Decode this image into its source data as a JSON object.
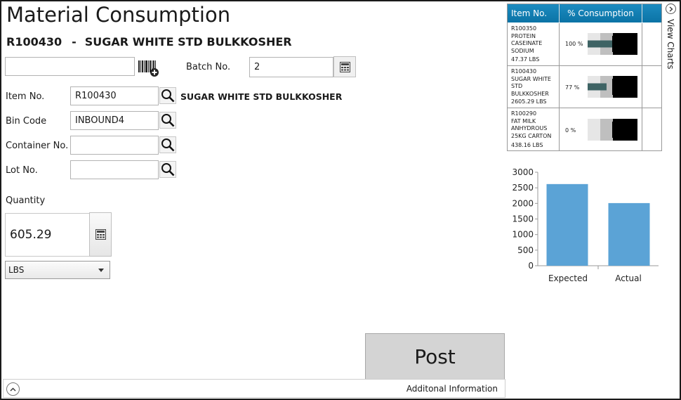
{
  "header": {
    "title": "Material Consumption",
    "item_code": "R100430",
    "separator": "-",
    "item_desc": "SUGAR WHITE STD BULKKOSHER"
  },
  "scan": {
    "value": "",
    "barcode_icon": "barcode-scan-icon"
  },
  "batch": {
    "label": "Batch No.",
    "value": "2",
    "calc_icon": "calculator-icon"
  },
  "form": {
    "item": {
      "label": "Item No.",
      "value": "R100430",
      "desc": "SUGAR WHITE STD BULKKOSHER"
    },
    "bin": {
      "label": "Bin Code",
      "value": "INBOUND4"
    },
    "container": {
      "label": "Container No.",
      "value": ""
    },
    "lot": {
      "label": "Lot No.",
      "value": ""
    },
    "search_icon": "magnifier-icon"
  },
  "quantity": {
    "label": "Quantity",
    "value": "605.29",
    "uom": "LBS"
  },
  "actions": {
    "post_label": "Post"
  },
  "footer": {
    "info_label": "Additonal Information",
    "expand_icon": "chevron-up-icon"
  },
  "side_tab": {
    "label": "View Charts",
    "icon": "chevron-right-icon"
  },
  "consumption_table": {
    "headers": [
      "Item No.",
      "% Consumption"
    ],
    "rows": [
      {
        "item_no": "R100350",
        "desc_lines": [
          "PROTEIN",
          "CASEINATE",
          "SODIUM"
        ],
        "qty": "47.37  LBS",
        "pct_label": "100 %",
        "pct": 100
      },
      {
        "item_no": "R100430",
        "desc_lines": [
          "SUGAR WHITE",
          "STD BULKKOSHER"
        ],
        "qty": "2605.29  LBS",
        "pct_label": "77 %",
        "pct": 77
      },
      {
        "item_no": "R100290",
        "desc_lines": [
          "FAT MILK",
          "ANHYDROUS",
          "25KG CARTON"
        ],
        "qty": "438.16  LBS",
        "pct_label": "0 %",
        "pct": 0
      }
    ],
    "colors": {
      "header": "#0b73a6",
      "bar": "#3e6364",
      "band1": "#e6e6e6",
      "band2": "#bfbfbf",
      "band3": "#000000"
    }
  },
  "chart_data": {
    "type": "bar",
    "categories": [
      "Expected",
      "Actual"
    ],
    "values": [
      2620,
      2010
    ],
    "ylim": [
      0,
      3000
    ],
    "yticks": [
      0,
      500,
      1000,
      1500,
      2000,
      2500,
      3000
    ],
    "yticks_labels": [
      "0",
      "500",
      "1000",
      "1500",
      "2000",
      "2500",
      "3000"
    ],
    "bar_color": "#5ba3d6",
    "grid": false
  }
}
